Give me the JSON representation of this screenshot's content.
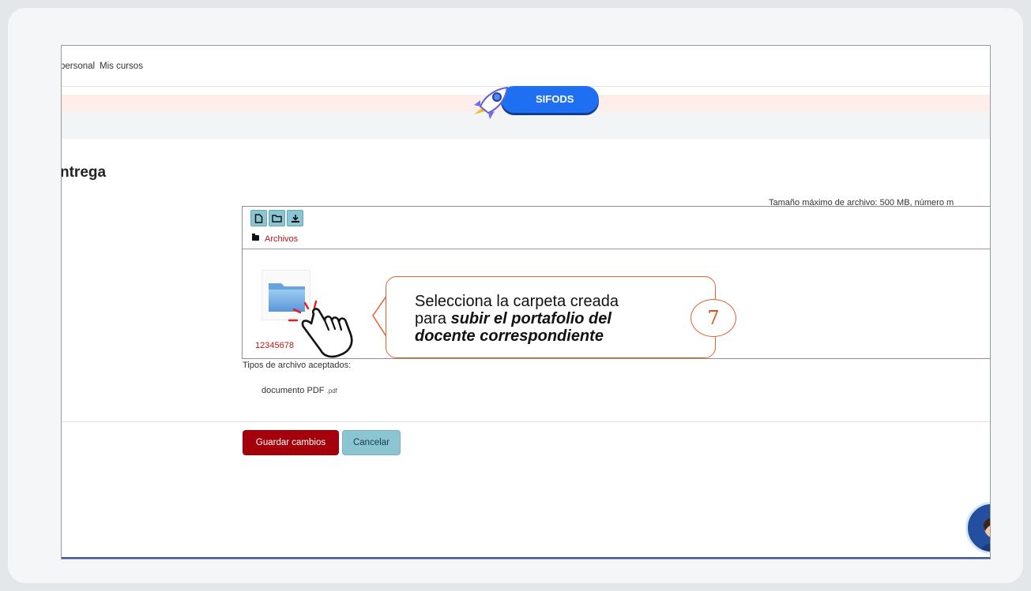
{
  "nav": {
    "item_personal": "personal",
    "item_courses": "Mis cursos"
  },
  "brand": {
    "label": "SIFODS"
  },
  "page": {
    "heading": "ntrega"
  },
  "upload": {
    "max_size_text": "Tamaño máximo de archivo: 500 MB, número m",
    "toolbar": {
      "icons": [
        "new-file-icon",
        "new-folder-icon",
        "download-icon"
      ]
    },
    "path_label": "Archivos",
    "folder_name": "12345678",
    "accepted_label": "Tipos de archivo aceptados:",
    "accepted_type_name": "documento PDF",
    "accepted_type_ext": ".pdf"
  },
  "actions": {
    "save_label": "Guardar cambios",
    "cancel_label": "Cancelar"
  },
  "callout": {
    "text_lead": "Selecciona la carpeta creada",
    "text_para": "para",
    "text_bold_1": "subir el portafolio del",
    "text_bold_2": "docente correspondiente",
    "step_number": "7"
  },
  "colors": {
    "accent_red": "#a3000b",
    "accent_teal": "#8cc5d2",
    "callout_orange": "#e0632e",
    "brand_blue": "#1f6ff2"
  }
}
